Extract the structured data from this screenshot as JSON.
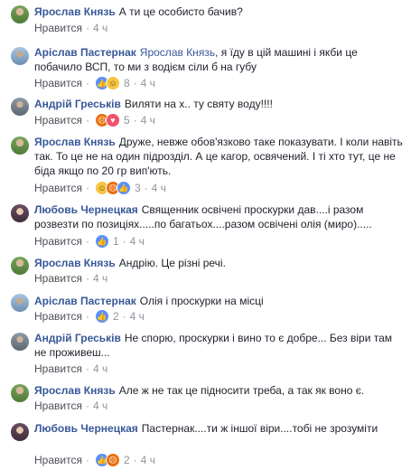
{
  "comments": [
    {
      "author": "Ярослав Князь",
      "text": "А ти це особисто бачив?",
      "like": "Нравится",
      "reactions": [],
      "count": "",
      "time": "4 ч"
    },
    {
      "author": "Аріслав Пастернак",
      "mention": "Ярослав Князь",
      "text": ", я їду в цій машині і якби це побачило ВСП, то ми з водієм сіли б на губу",
      "like": "Нравится",
      "reactions": [
        "like-icon",
        "haha-icon"
      ],
      "count": "8",
      "time": "4 ч"
    },
    {
      "author": "Андрій Греськів",
      "text": "Виляти на х.. ту святу воду!!!!",
      "like": "Нравится",
      "reactions": [
        "angry-icon",
        "love-icon"
      ],
      "count": "5",
      "time": "4 ч"
    },
    {
      "author": "Ярослав Князь",
      "text": "Друже, невже обов'язково таке показувати. І коли навіть так. То це не на один підрозділ. А це кагор, освячений. І ті хто тут, це не біда якщо по 20 гр вип'ють.",
      "like": "Нравится",
      "reactions": [
        "haha-icon",
        "angry-icon",
        "like-icon"
      ],
      "count": "3",
      "time": "4 ч"
    },
    {
      "author": "Любовь Чернецкая",
      "text": "Священник освічені проскурки дав....і разом розвезти по позиціях.....по багатьох....разом освічені олія (миро).....",
      "like": "Нравится",
      "reactions": [
        "like-icon"
      ],
      "count": "1",
      "time": "4 ч"
    },
    {
      "author": "Ярослав Князь",
      "text": "Андрію. Це різні речі.",
      "like": "Нравится",
      "reactions": [],
      "count": "",
      "time": "4 ч"
    },
    {
      "author": "Аріслав Пастернак",
      "text": "Олія і проскурки на місці",
      "like": "Нравится",
      "reactions": [
        "like-icon"
      ],
      "count": "2",
      "time": "4 ч"
    },
    {
      "author": "Андрій Греськів",
      "text": "Не спорю, проскурки і вино то є добре... Без віри там не проживеш...",
      "like": "Нравится",
      "reactions": [],
      "count": "",
      "time": "4 ч"
    },
    {
      "author": "Ярослав Князь",
      "text": "Але ж не так це підносити треба, а так як воно є.",
      "like": "Нравится",
      "reactions": [],
      "count": "",
      "time": "4 ч"
    },
    {
      "author": "Любовь Чернецкая",
      "text": "Пастернак....ти ж іншої віри....тобі не зрозуміти",
      "like": "Нравится",
      "reactions": [
        "like-icon",
        "angry-icon"
      ],
      "count": "2",
      "time": "4 ч"
    }
  ],
  "colors": {
    "author": "#385898",
    "meta": "#90949c",
    "text": "#1d2129"
  }
}
